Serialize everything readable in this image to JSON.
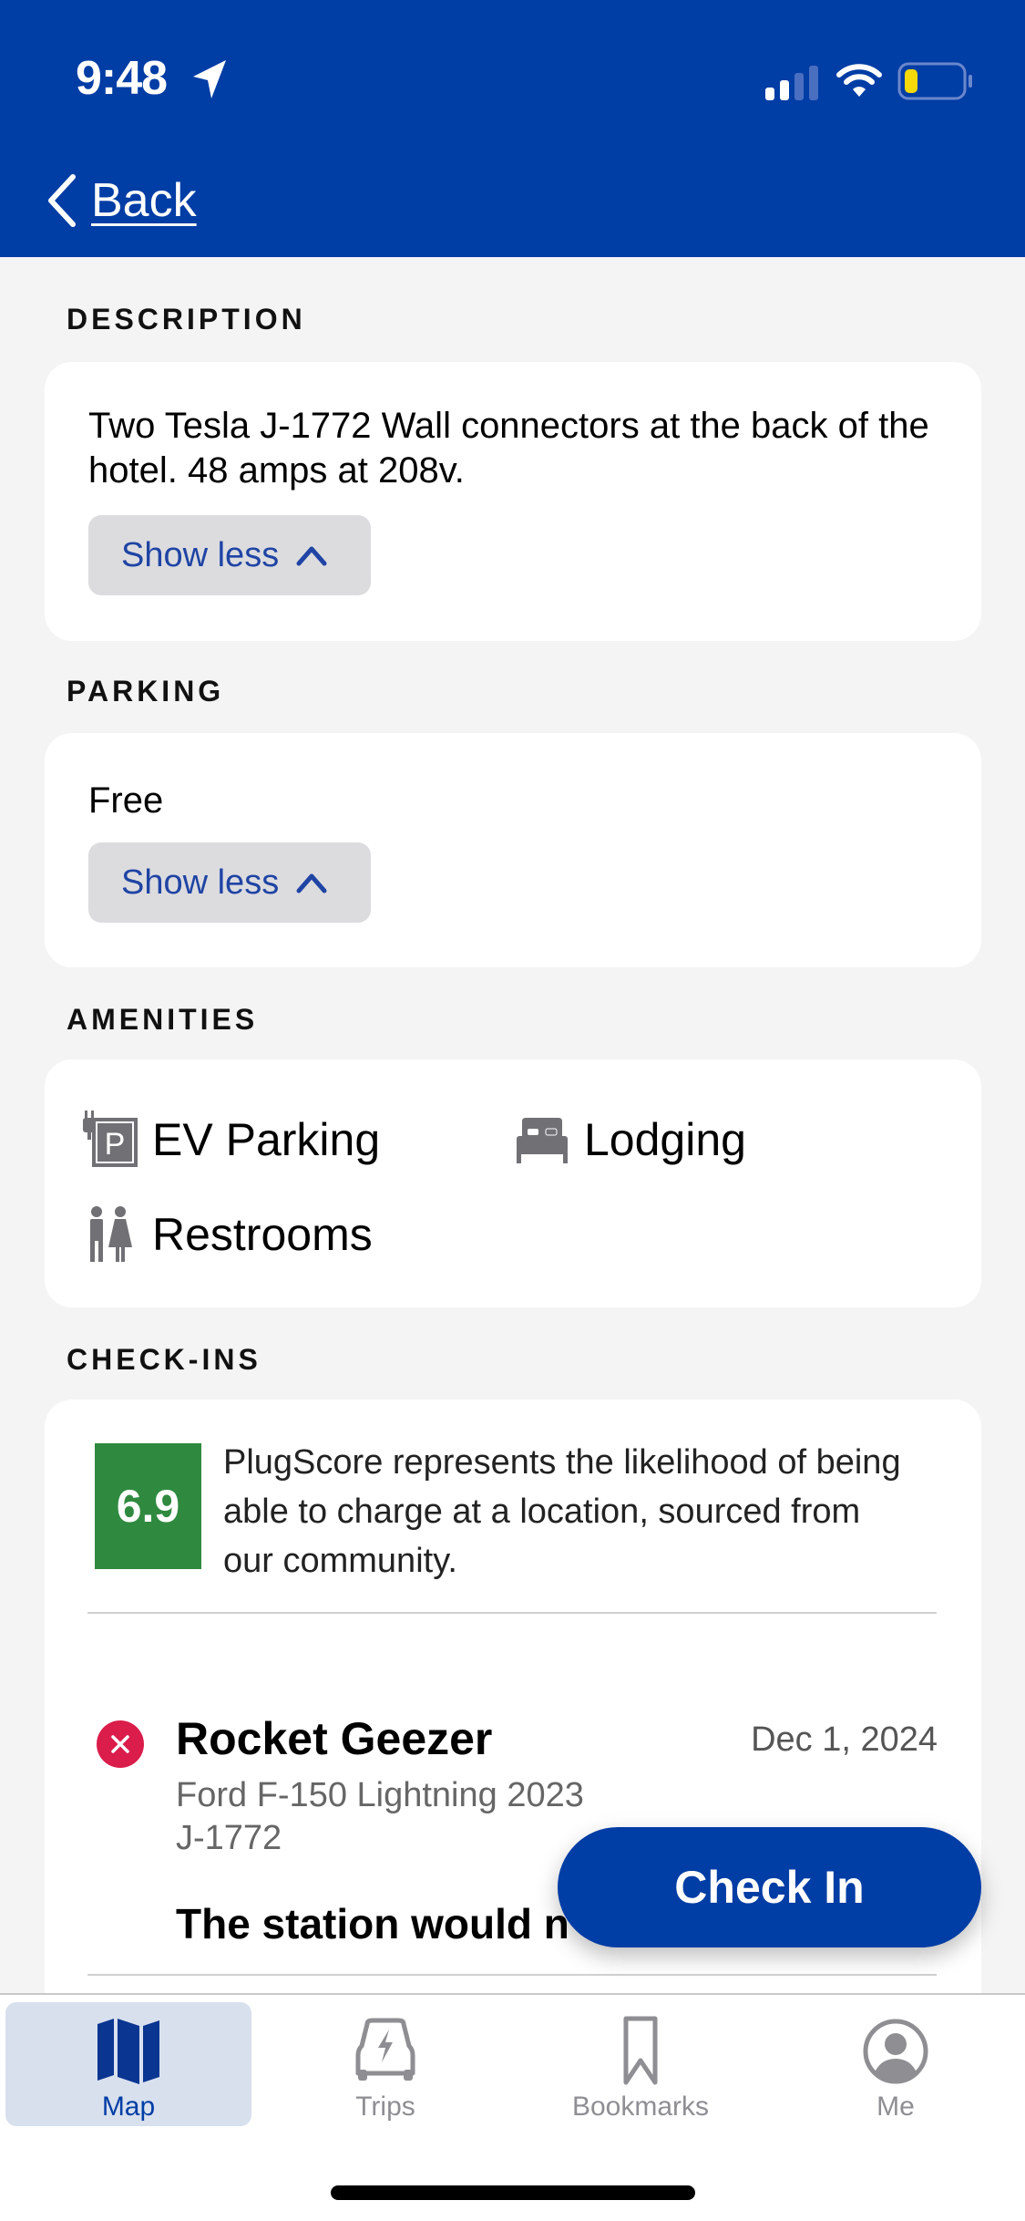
{
  "status_bar": {
    "time": "9:48",
    "battery_color": "#f5d90a"
  },
  "header": {
    "back_label": "Back",
    "background_color": "#003da5"
  },
  "description": {
    "title": "DESCRIPTION",
    "text": "Two Tesla J-1772 Wall connectors at the back of the hotel. 48 amps at 208v.",
    "toggle_label": "Show less"
  },
  "parking": {
    "title": "PARKING",
    "text": "Free",
    "toggle_label": "Show less"
  },
  "amenities": {
    "title": "AMENITIES",
    "items": [
      {
        "label": "EV Parking",
        "icon": "ev-parking-icon"
      },
      {
        "label": "Lodging",
        "icon": "bed-icon"
      },
      {
        "label": "Restrooms",
        "icon": "restroom-icon"
      }
    ]
  },
  "checkins": {
    "title": "CHECK-INS",
    "plugscore": {
      "value": "6.9",
      "description": "PlugScore represents the likelihood of being able to charge at a location, sourced from our community.",
      "color": "#2f8a3f"
    },
    "items": [
      {
        "status": "failed",
        "status_color": "#db1d4c",
        "user": "Rocket Geezer",
        "date": "Dec 1, 2024",
        "vehicle": "Ford F-150 Lightning 2023",
        "plug": "J-1772",
        "comment": "The station would n"
      }
    ]
  },
  "check_in_button": {
    "label": "Check In"
  },
  "tabbar": {
    "tabs": [
      {
        "label": "Map",
        "icon": "map-icon",
        "active": true
      },
      {
        "label": "Trips",
        "icon": "car-charging-icon",
        "active": false
      },
      {
        "label": "Bookmarks",
        "icon": "bookmark-icon",
        "active": false
      },
      {
        "label": "Me",
        "icon": "profile-icon",
        "active": false
      }
    ]
  }
}
